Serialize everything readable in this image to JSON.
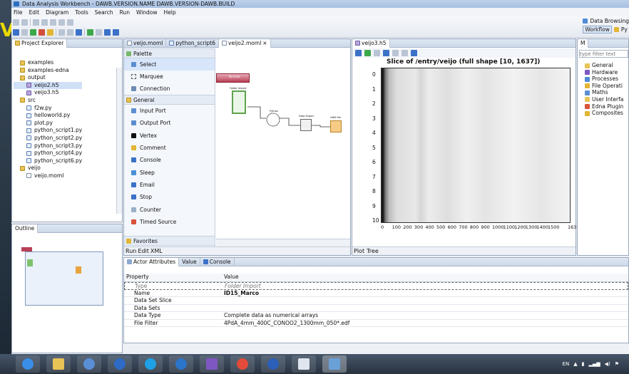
{
  "window": {
    "title": "Data Analysis Workbench  -  DAWB.VERSION.NAME    DAWB.VERSION-DAWB.BUILD"
  },
  "menu": [
    "File",
    "Edit",
    "Diagram",
    "Tools",
    "Search",
    "Run",
    "Window",
    "Help"
  ],
  "perspectives": {
    "data_browsing": "Data Browsing",
    "workflow": "Workflow",
    "py": "Py"
  },
  "project_explorer": {
    "tab": "Project Explorer",
    "items": [
      {
        "label": "examples",
        "type": "folder",
        "indent": 1
      },
      {
        "label": "examples-edna",
        "type": "folder",
        "indent": 1
      },
      {
        "label": "output",
        "type": "folder",
        "indent": 1
      },
      {
        "label": "veijo2.h5",
        "type": "h5",
        "indent": 2,
        "selected": true
      },
      {
        "label": "veijo3.h5",
        "type": "h5",
        "indent": 2
      },
      {
        "label": "src",
        "type": "folder",
        "indent": 1
      },
      {
        "label": "f2w.py",
        "type": "py",
        "indent": 2
      },
      {
        "label": "helloworld.py",
        "type": "py",
        "indent": 2
      },
      {
        "label": "plot.py",
        "type": "py",
        "indent": 2
      },
      {
        "label": "python_script1.py",
        "type": "py",
        "indent": 2
      },
      {
        "label": "python_script2.py",
        "type": "py",
        "indent": 2
      },
      {
        "label": "python_script3.py",
        "type": "py",
        "indent": 2
      },
      {
        "label": "python_script4.py",
        "type": "py",
        "indent": 2
      },
      {
        "label": "python_script6.py",
        "type": "py",
        "indent": 2
      },
      {
        "label": "veijo",
        "type": "folder",
        "indent": 1
      },
      {
        "label": "veijo.moml",
        "type": "file",
        "indent": 2
      }
    ]
  },
  "outline": {
    "tab": "Outline"
  },
  "editor_tabs": [
    "veijo.moml",
    "python_script6",
    "veijo2.moml"
  ],
  "palette": {
    "title": "Palette",
    "tools": [
      "Select",
      "Marquee",
      "Connection"
    ],
    "general_label": "General",
    "general_items": [
      "Input Port",
      "Output Port",
      "Vertex",
      "Comment",
      "Console",
      "Sleep",
      "Email",
      "Stop",
      "Counter",
      "Timed Source"
    ],
    "favorites_label": "Favorites"
  },
  "diagram": {
    "director_label": "Director",
    "nodes": [
      "Folder Import",
      "Python",
      "Data Export",
      "Hdf5 file"
    ]
  },
  "editor_bottom_tabs": [
    "Run",
    "Edit",
    "XML"
  ],
  "plot": {
    "tab": "veijo3.h5",
    "title": "Slice of /entry/veijo (full shape [10, 1637])",
    "y_ticks": [
      "0",
      "1",
      "2",
      "3",
      "4",
      "5",
      "6",
      "7",
      "8",
      "9",
      "10"
    ],
    "x_ticks": [
      "0",
      "100",
      "200",
      "300",
      "400",
      "500",
      "600",
      "700",
      "800",
      "900",
      "1000",
      "1100",
      "1200",
      "1300",
      "1400",
      "1500",
      "1637"
    ],
    "bottom_tabs": [
      "Plot",
      "Tree"
    ]
  },
  "right_panel": {
    "filter_placeholder": "type filter text",
    "items": [
      "General",
      "Hardware",
      "Processes",
      "File Operati",
      "Maths",
      "User Interfa",
      "Edna Plugin",
      "Composites"
    ]
  },
  "attributes": {
    "tabs": [
      "Actor Attributes",
      "Value",
      "Console"
    ],
    "header": [
      "Property",
      "Value"
    ],
    "rows": [
      {
        "property": "Type",
        "value": "Folder Import"
      },
      {
        "property": "Name",
        "value": "ID15_Marco"
      },
      {
        "property": "Data Set Slice",
        "value": ""
      },
      {
        "property": "Data Sets",
        "value": ""
      },
      {
        "property": "Data Type",
        "value": "Complete data as numerical arrays"
      },
      {
        "property": "File Filter",
        "value": "4PdA_4mm_400C_CONOO2_1300mm_050*.edf"
      }
    ]
  },
  "tray": {
    "lang": "EN"
  },
  "desktop_letter": "V"
}
